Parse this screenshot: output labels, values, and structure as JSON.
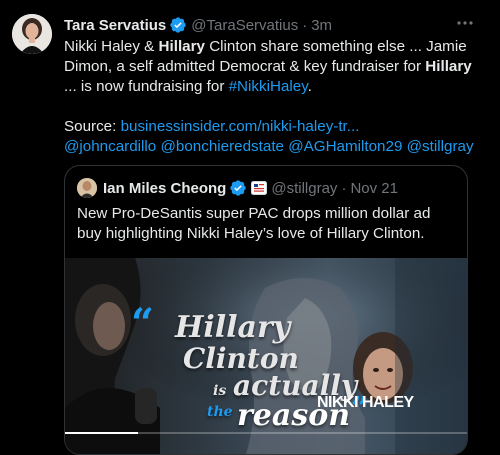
{
  "tweet": {
    "author_name": "Tara Servatius",
    "author_handle": "@TaraServatius",
    "separator": "·",
    "time": "3m",
    "text_line_1_part_1": "Nikki Haley & ",
    "text_line_1_hl": "Hillary",
    "text_line_1_part_2": " Clinton share something else ... Jamie",
    "text_line_2_part_1": "Dimon, a self admitted Democrat & key fundraiser for ",
    "text_line_2_hl": "Hillary",
    "text_line_3_part_1": "... is now fundraising for ",
    "text_line_3_hashtag": "#NikkiHaley",
    "text_line_3_part_2": ".",
    "source_label": "Source: ",
    "source_link": "businessinsider.com/nikki-haley-tr...",
    "mentions": [
      "@johncardillo",
      "@bonchieredstate",
      "@AGHamilton29",
      "@stillgray"
    ]
  },
  "quoted": {
    "author_name": "Ian Miles Cheong",
    "author_handle": "@stillgray",
    "separator": "·",
    "time": "Nov 21",
    "text": "New Pro-DeSantis super PAC drops million dollar ad buy highlighting Nikki Haley’s love of Hillary Clinton.",
    "media": {
      "quote_open": "“",
      "line_1": "Hillary",
      "line_2": "Clinton",
      "line_3_small": "is",
      "line_3": "actually",
      "line_4_small": "the",
      "line_4": "reason",
      "quote_close": "”",
      "caption": "NIKKI HALEY",
      "progress": 0.18
    }
  },
  "colors": {
    "background": "#000000",
    "text": "#e7e9ea",
    "secondary": "#71767b",
    "link": "#1d9bf0",
    "border": "#2f3336",
    "verified": "#1d9bf0"
  },
  "icons": [
    "verified-badge-icon",
    "more-options-icon",
    "affiliate-flag-icon"
  ]
}
